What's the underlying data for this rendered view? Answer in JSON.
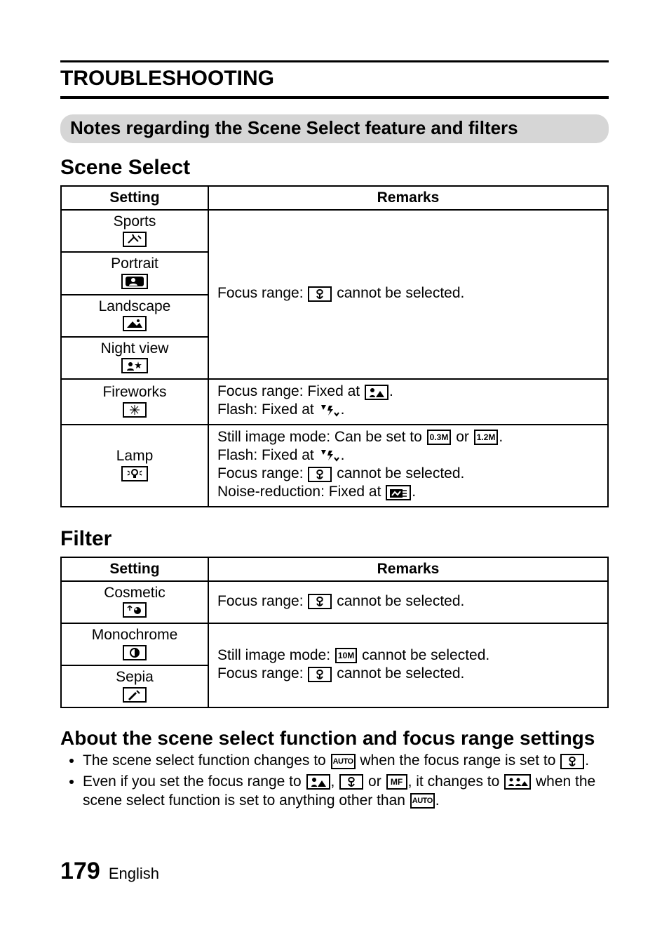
{
  "chapter_title": "TROUBLESHOOTING",
  "pill_title": "Notes regarding the Scene Select feature and filters",
  "scene_select": {
    "heading": "Scene Select",
    "col_setting": "Setting",
    "col_remarks": "Remarks",
    "rows": {
      "sports": "Sports",
      "portrait": "Portrait",
      "landscape": "Landscape",
      "night_view": "Night view",
      "fireworks": "Fireworks",
      "lamp": "Lamp"
    },
    "remark_group1_a": "Focus range: ",
    "remark_group1_b": " cannot be selected.",
    "fireworks_l1a": "Focus range: Fixed at ",
    "fireworks_l1b": ".",
    "fireworks_l2a": "Flash: Fixed at ",
    "fireworks_l2b": ".",
    "lamp_l1a": "Still image mode: Can be set to ",
    "lamp_l1_or": " or ",
    "lamp_l1b": ".",
    "lamp_l2a": "Flash: Fixed at ",
    "lamp_l2b": ".",
    "lamp_l3a": "Focus range: ",
    "lamp_l3b": " cannot be selected.",
    "lamp_l4a": "Noise-reduction: Fixed at ",
    "lamp_l4b": "."
  },
  "filter": {
    "heading": "Filter",
    "col_setting": "Setting",
    "col_remarks": "Remarks",
    "rows": {
      "cosmetic": "Cosmetic",
      "monochrome": "Monochrome",
      "sepia": "Sepia"
    },
    "cosmetic_a": "Focus range: ",
    "cosmetic_b": " cannot be selected.",
    "mono_l1a": "Still image mode: ",
    "mono_l1b": " cannot be selected.",
    "mono_l2a": "Focus range: ",
    "mono_l2b": " cannot be selected."
  },
  "about": {
    "heading": "About the scene select function and focus range settings",
    "b1_a": "The scene select function changes to ",
    "b1_b": " when the focus range is set to ",
    "b1_c": ".",
    "b2_a": "Even if you set the focus range to ",
    "b2_b": ", ",
    "b2_c": " or ",
    "b2_d": ", it changes to ",
    "b2_e": " when the scene select function is set to anything other than ",
    "b2_f": "."
  },
  "icons": {
    "auto": "AUTO",
    "mf": "MF",
    "m03": "0.3M",
    "m12": "1.2M",
    "m10": "10M"
  },
  "page_number": "179",
  "page_lang": "English"
}
